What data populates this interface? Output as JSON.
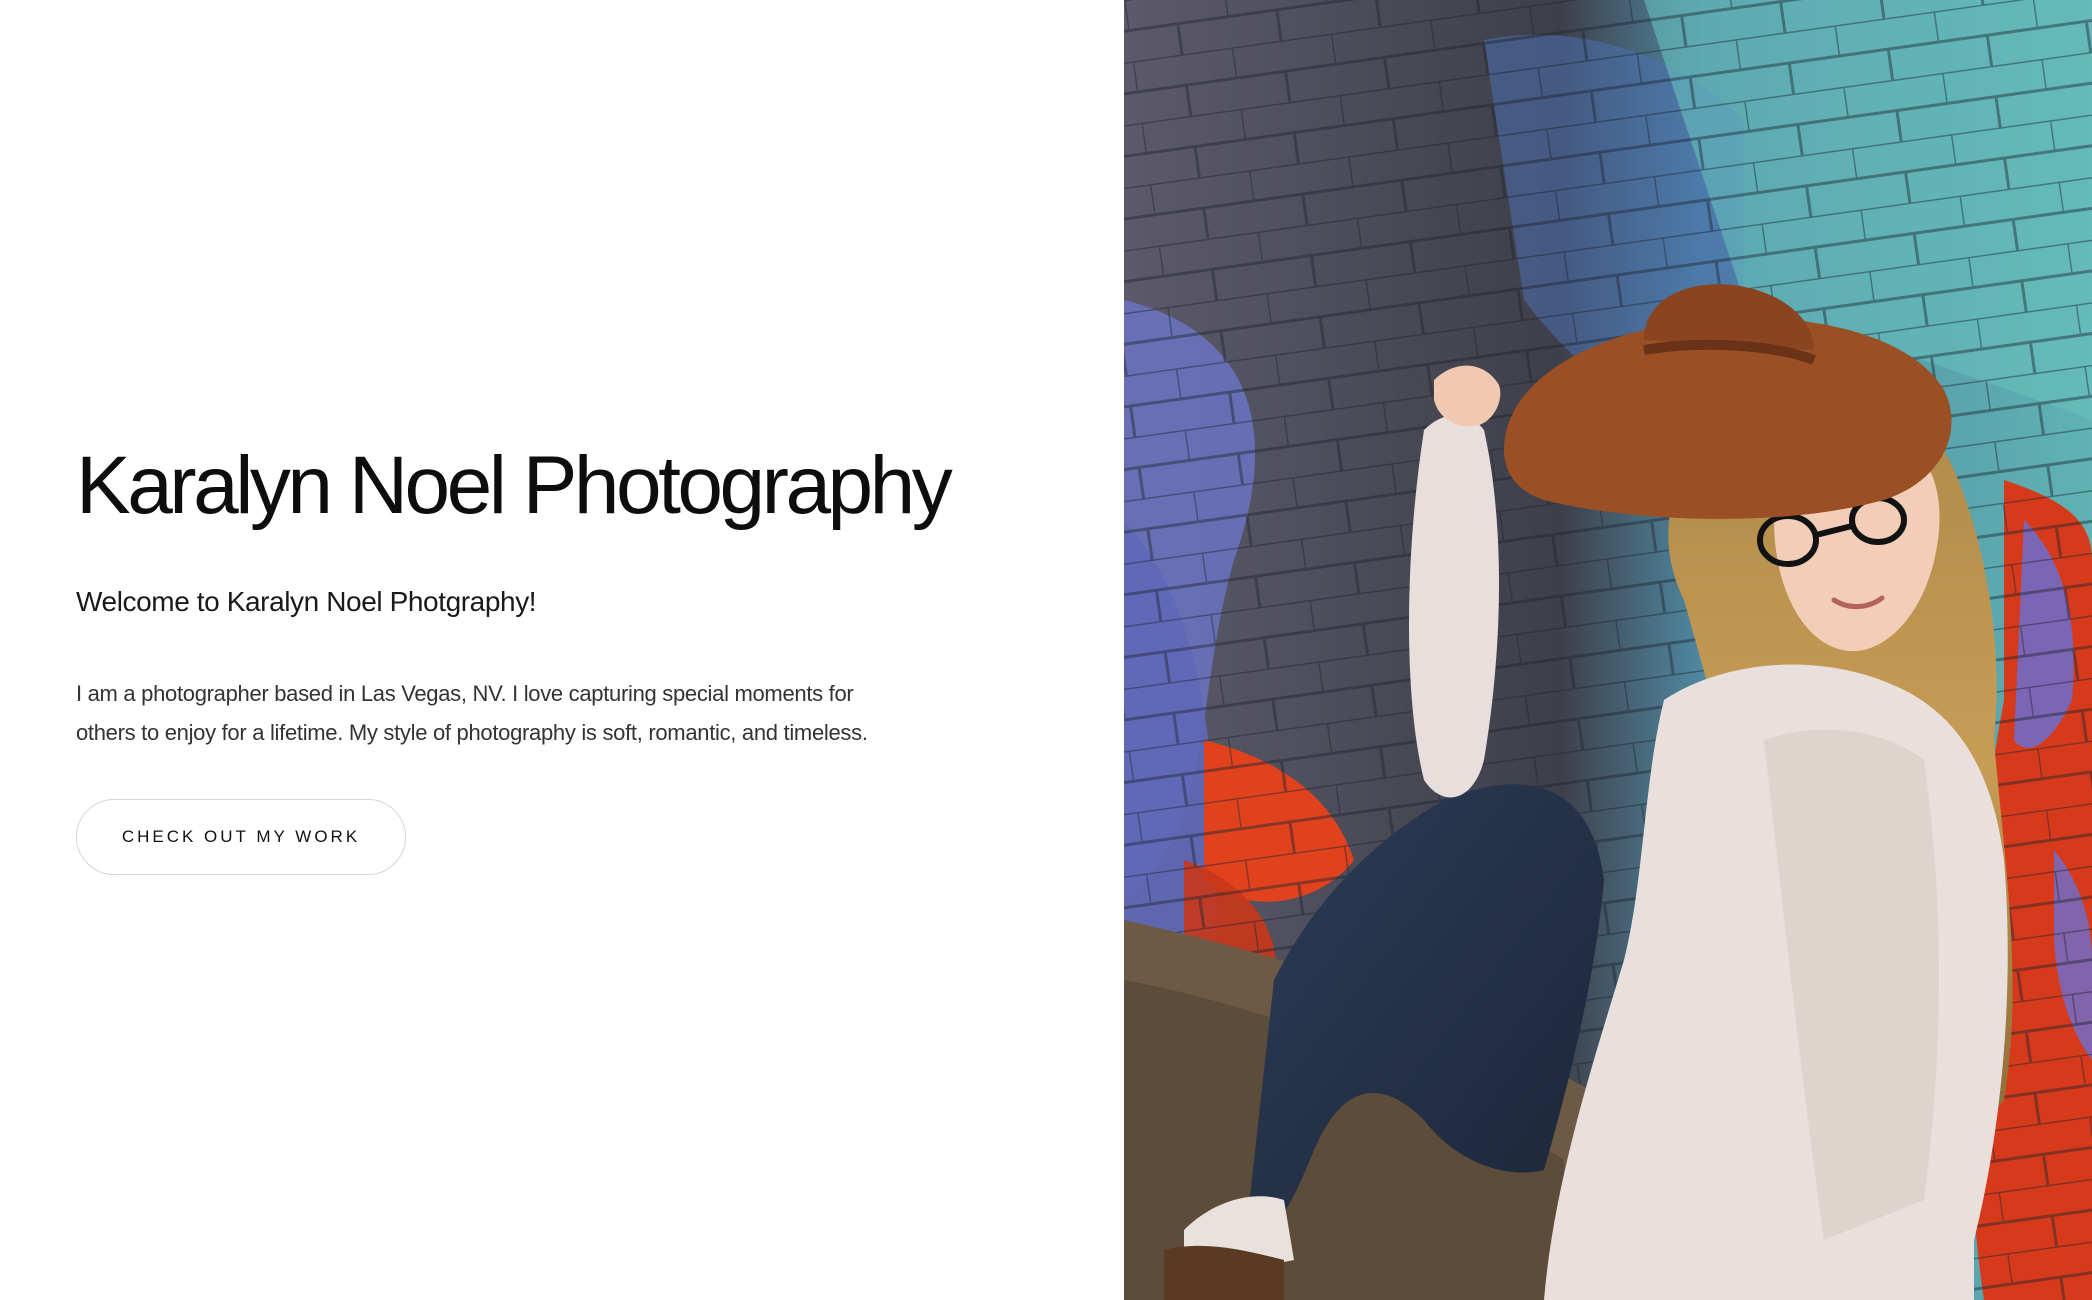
{
  "hero": {
    "title": "Karalyn Noel Photography",
    "subtitle": "Welcome to Karalyn Noel Photgraphy!",
    "description": "I am a photographer based in Las Vegas, NV. I love capturing special moments for others to enjoy for a lifetime. My style of photography is soft, romantic, and timeless.",
    "cta_label": "CHECK OUT MY WORK"
  },
  "colors": {
    "background": "#ffffff",
    "text": "#111111",
    "button_border": "#d6d6d6"
  },
  "photo": {
    "subject": "woman-in-hat-and-glasses-against-graffiti-wall"
  }
}
